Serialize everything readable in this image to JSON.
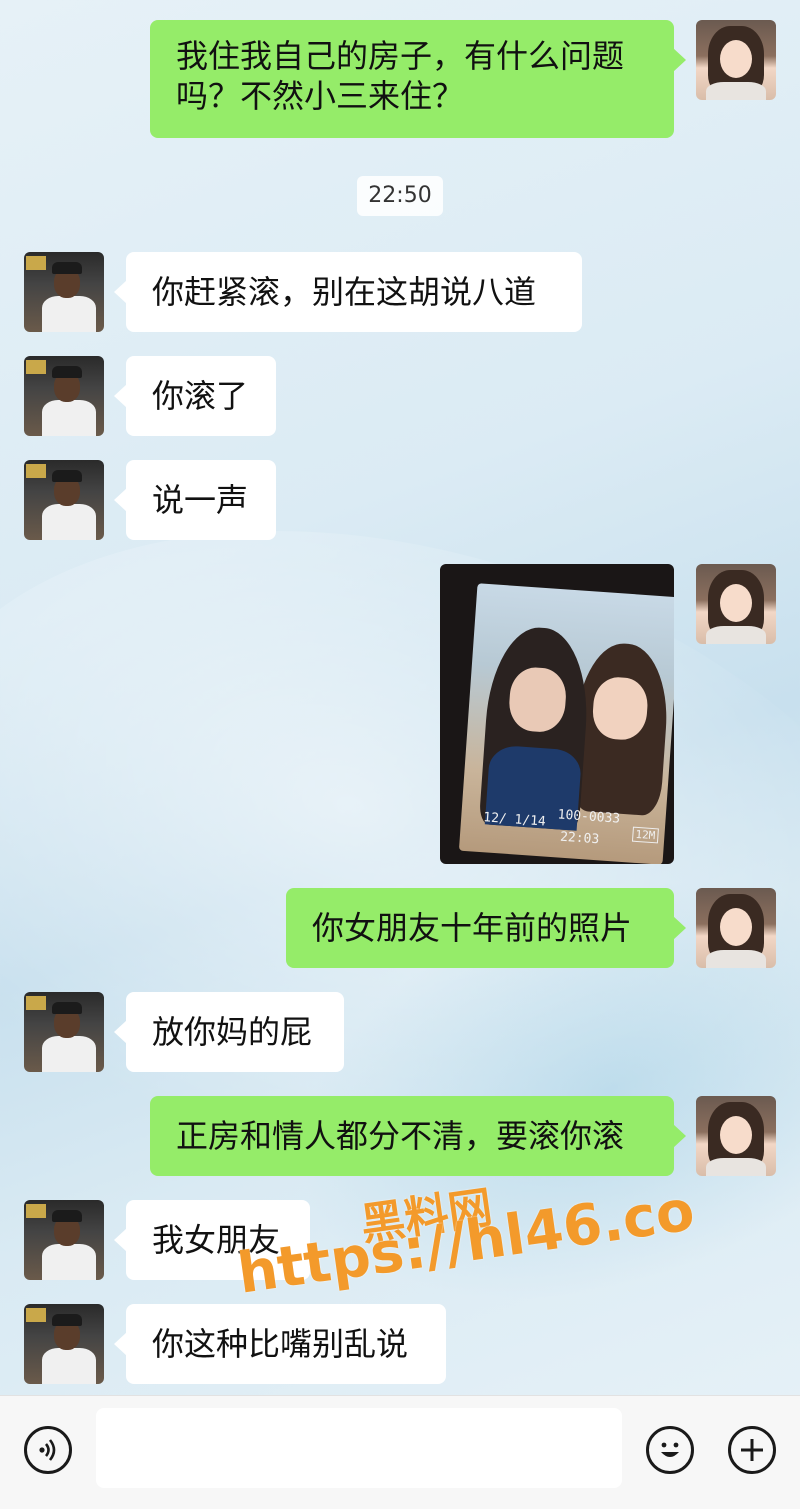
{
  "messages": [
    {
      "side": "out",
      "text": "我住我自己的房子，有什么问题吗？不然小三来住？"
    },
    {
      "side": "time",
      "text": "22:50"
    },
    {
      "side": "in",
      "text": "你赶紧滚，别在这胡说八道"
    },
    {
      "side": "in",
      "text": "你滚了"
    },
    {
      "side": "in",
      "text": "说一声"
    },
    {
      "side": "out",
      "type": "image"
    },
    {
      "side": "out",
      "text": "你女朋友十年前的照片"
    },
    {
      "side": "in",
      "text": "放你妈的屁"
    },
    {
      "side": "out",
      "text": "正房和情人都分不清，要滚你滚"
    },
    {
      "side": "in",
      "text": "我女朋友"
    },
    {
      "side": "in",
      "text": "你这种比嘴别乱说"
    }
  ],
  "photo_overlay": {
    "file_no": "100-0033",
    "size_badge": "12M",
    "date": "12/  1/14",
    "time": "22:03"
  },
  "watermark": {
    "title": "黑料网",
    "url": "https://hl46.co"
  },
  "input_bar": {
    "voice_icon": "voice-icon",
    "emoji_icon": "emoji-icon",
    "plus_icon": "plus-icon",
    "value": ""
  },
  "colors": {
    "outgoing_bubble": "#95ec69",
    "incoming_bubble": "#ffffff",
    "watermark": "#f39a2b"
  }
}
